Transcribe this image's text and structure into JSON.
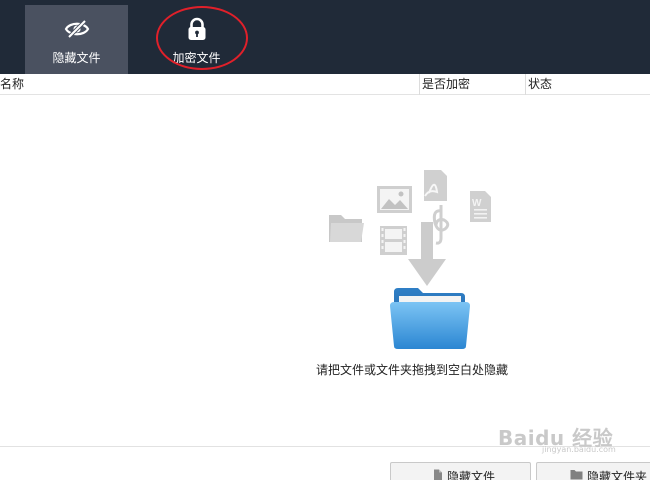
{
  "toolbar": {
    "hide_files_label": "隐藏文件",
    "encrypt_files_label": "加密文件",
    "active_tab": "hide_files",
    "background_color": "#202a38",
    "active_color": "#4a5160"
  },
  "annotation": {
    "color": "#e0202a",
    "shape": "ellipse",
    "target": "encrypt_files"
  },
  "file_table": {
    "columns": [
      "名称",
      "是否加密",
      "状态"
    ],
    "rows": []
  },
  "drop_zone": {
    "hint": "请把文件或文件夹拖拽到空白处隐藏",
    "icons": [
      "folder-icon",
      "image-icon",
      "pdf-icon",
      "video-icon",
      "music-icon",
      "word-document-icon",
      "down-arrow-icon",
      "blue-folder-icon"
    ]
  },
  "footer": {
    "hide_file_button": "隐藏文件",
    "hide_folder_button": "隐藏文件夹"
  },
  "watermark": {
    "brand": "Baidu 经验",
    "sub": "jingyan.baidu.com"
  }
}
